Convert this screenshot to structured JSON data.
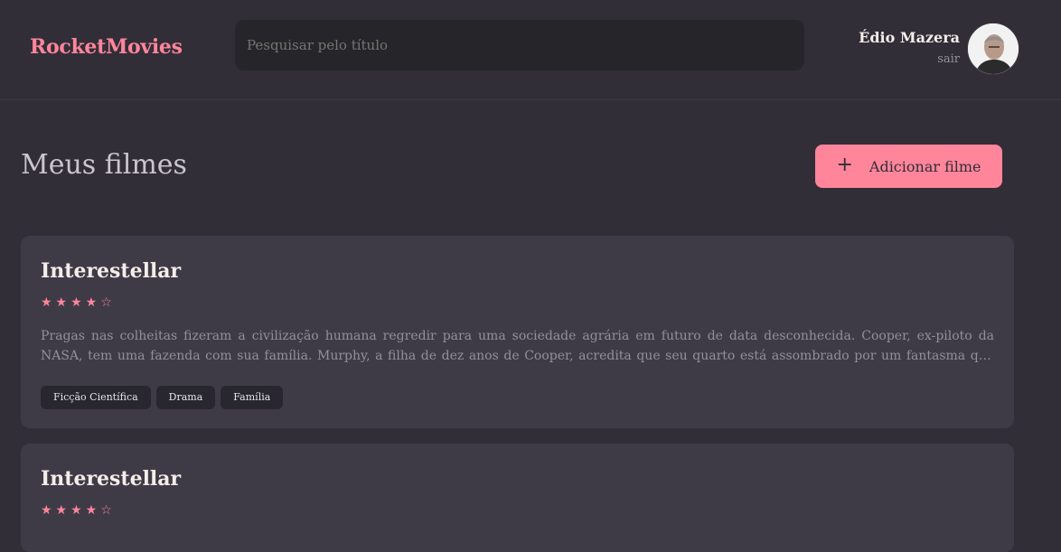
{
  "header": {
    "brand": "RocketMovies",
    "search_placeholder": "Pesquisar pelo título",
    "user_name": "Édio Mazera",
    "logout_label": "sair"
  },
  "main": {
    "title": "Meus filmes",
    "add_button_label": "Adicionar filme"
  },
  "movies": [
    {
      "title": "Interestellar",
      "rating": 4,
      "rating_max": 5,
      "stars": "★★★★☆",
      "description": "Pragas nas colheitas fizeram a civilização humana regredir para uma sociedade agrária em futuro de data desconhecida. Cooper, ex-piloto da NASA, tem uma fazenda com sua família. Murphy, a filha de dez anos de Cooper, acredita que seu quarto está assombrado por um fantasma que tenta se comunicar com ela.",
      "tags": [
        "Ficção Científica",
        "Drama",
        "Família"
      ]
    },
    {
      "title": "Interestellar",
      "rating": 4,
      "rating_max": 5,
      "stars": "★★★★☆"
    }
  ],
  "colors": {
    "accent": "#ff859b",
    "background": "#312e38",
    "card": "#3e3b47"
  }
}
